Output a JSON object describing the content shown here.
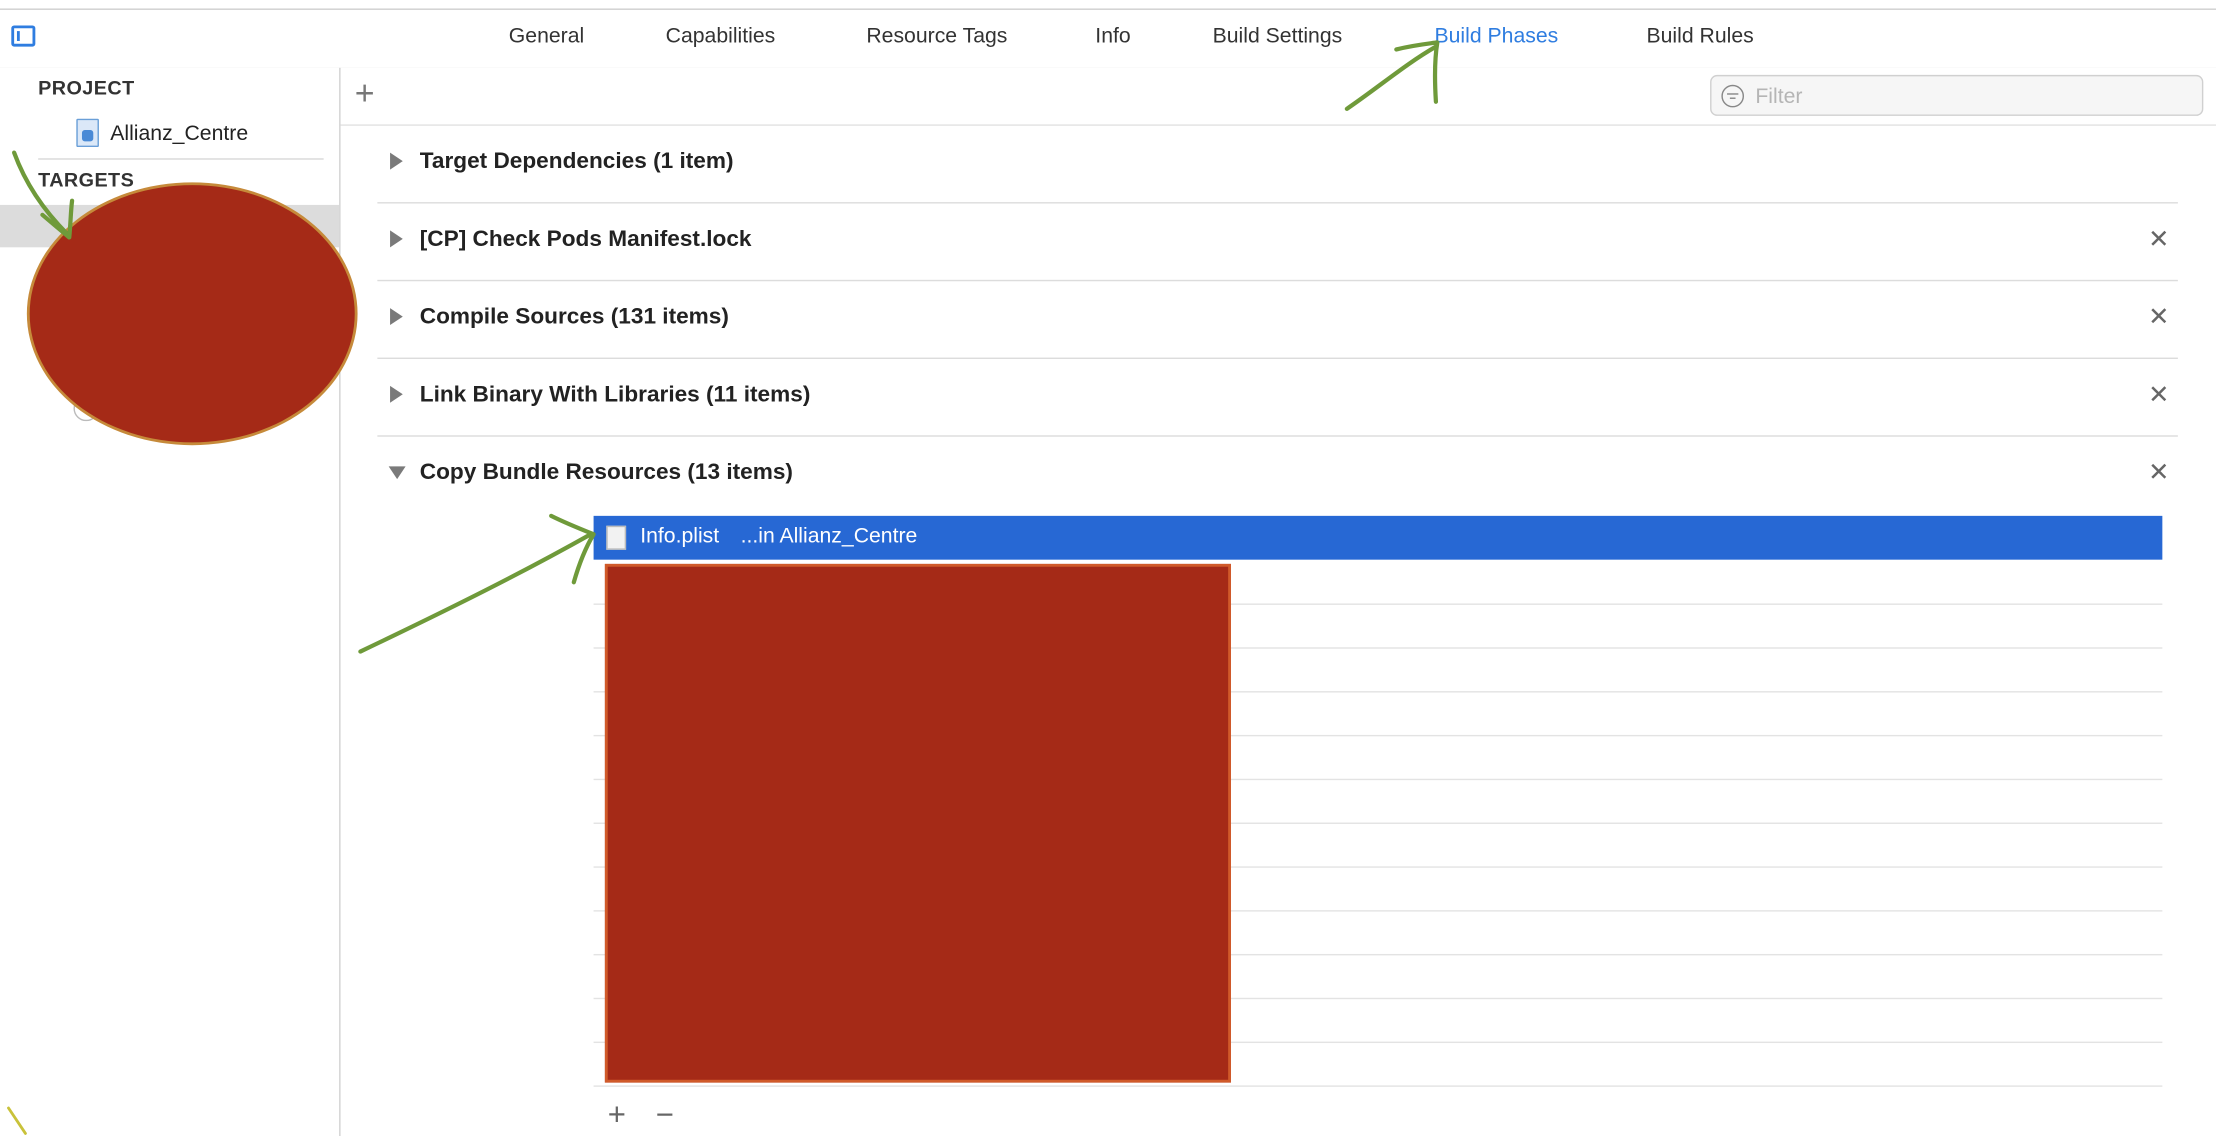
{
  "tabs": [
    {
      "label": "General",
      "active": false
    },
    {
      "label": "Capabilities",
      "active": false
    },
    {
      "label": "Resource Tags",
      "active": false
    },
    {
      "label": "Info",
      "active": false
    },
    {
      "label": "Build Settings",
      "active": false
    },
    {
      "label": "Build Phases",
      "active": true
    },
    {
      "label": "Build Rules",
      "active": false
    }
  ],
  "sidebar": {
    "project_header": "PROJECT",
    "project_name": "Allianz_Centre",
    "targets_header": "TARGETS"
  },
  "toolbar": {
    "filter_placeholder": "Filter"
  },
  "phases": [
    {
      "title": "Target Dependencies (1 item)",
      "expanded": false,
      "removable": false
    },
    {
      "title": "[CP] Check Pods Manifest.lock",
      "expanded": false,
      "removable": true
    },
    {
      "title": "Compile Sources (131 items)",
      "expanded": false,
      "removable": true
    },
    {
      "title": "Link Binary With Libraries (11 items)",
      "expanded": false,
      "removable": true
    },
    {
      "title": "Copy Bundle Resources (13 items)",
      "expanded": true,
      "removable": true
    }
  ],
  "copy_bundle_resources": {
    "selected_file": {
      "name": "Info.plist",
      "location": "...in Allianz_Centre"
    }
  },
  "colors": {
    "accent": "#2f7de0",
    "selection": "#2768d4",
    "redaction": "#a52a17",
    "annotation_arrow": "#6f9a3a"
  }
}
